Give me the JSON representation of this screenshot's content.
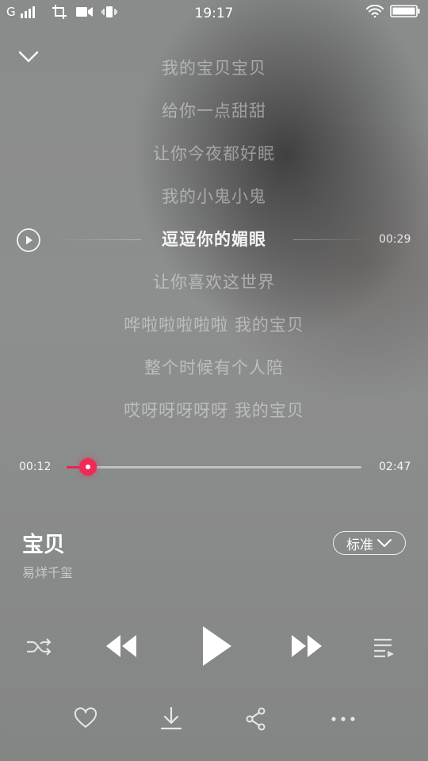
{
  "status_bar": {
    "carrier": "G",
    "time": "19:17"
  },
  "lyrics": {
    "lines": [
      "我的宝贝宝贝",
      "给你一点甜甜",
      "让你今夜都好眠",
      "我的小鬼小鬼",
      "逗逗你的媚眼",
      "让你喜欢这世界",
      "哗啦啦啦啦啦 我的宝贝",
      "整个时候有个人陪",
      "哎呀呀呀呀呀 我的宝贝"
    ],
    "current_index": 4,
    "current_line_time": "00:29"
  },
  "progress": {
    "elapsed": "00:12",
    "total": "02:47",
    "fraction": 0.072
  },
  "song": {
    "title": "宝贝",
    "artist": "易烊千玺",
    "quality_label": "标准"
  },
  "colors": {
    "accent": "#e9234f"
  },
  "icons": {
    "collapse": "chevron-down-icon",
    "lyric_play": "play-circle-icon",
    "shuffle": "shuffle-icon",
    "previous": "previous-icon",
    "play": "play-icon",
    "next": "next-icon",
    "playlist": "playlist-icon",
    "favorite": "heart-icon",
    "download": "download-icon",
    "share": "share-icon",
    "more": "more-icon"
  }
}
